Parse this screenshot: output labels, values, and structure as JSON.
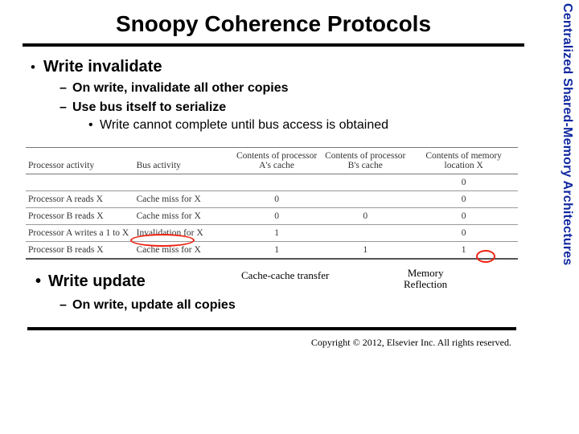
{
  "sideLabel": "Centralized Shared-Memory Architectures",
  "title": "Snoopy Coherence Protocols",
  "bullets": {
    "writeInvalidate": "Write invalidate",
    "sub1": "On write, invalidate all other copies",
    "sub2": "Use bus itself to serialize",
    "sub3": "Write cannot complete until bus access is obtained",
    "writeUpdate": "Write update",
    "subUpdate": "On write, update all copies"
  },
  "table": {
    "headers": {
      "c0": "Processor activity",
      "c1": "Bus activity",
      "c2": "Contents of processor A's cache",
      "c3": "Contents of processor B's cache",
      "c4": "Contents of memory location X"
    },
    "rows": [
      {
        "c0": "",
        "c1": "",
        "c2": "",
        "c3": "",
        "c4": "0"
      },
      {
        "c0": "Processor A reads X",
        "c1": "Cache miss for X",
        "c2": "0",
        "c3": "",
        "c4": "0"
      },
      {
        "c0": "Processor B reads X",
        "c1": "Cache miss for X",
        "c2": "0",
        "c3": "0",
        "c4": "0"
      },
      {
        "c0": "Processor A writes a 1 to X",
        "c1": "Invalidation for X",
        "c2": "1",
        "c3": "",
        "c4": "0"
      },
      {
        "c0": "Processor B reads X",
        "c1": "Cache miss for X",
        "c2": "1",
        "c3": "1",
        "c4": "1"
      }
    ]
  },
  "annotations": {
    "cacheTransfer": "Cache-cache transfer",
    "memReflect1": "Memory",
    "memReflect2": "Reflection"
  },
  "copyright": "Copyright © 2012, Elsevier Inc. All rights reserved."
}
